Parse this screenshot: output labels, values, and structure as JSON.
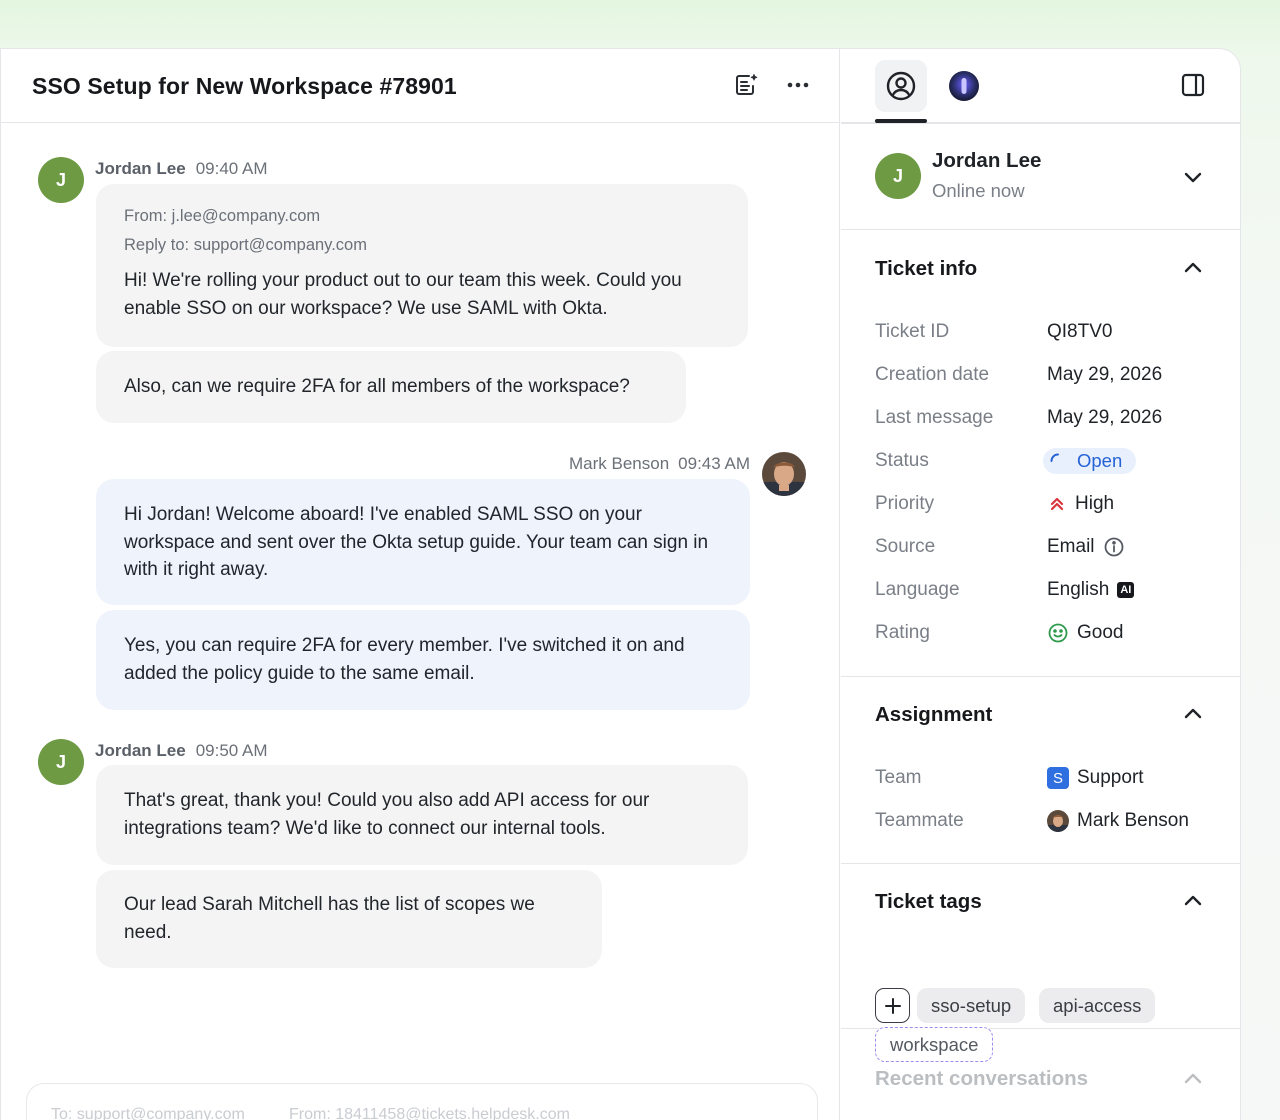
{
  "ticket": {
    "title": "SSO Setup for New Workspace #78901"
  },
  "messages": [
    {
      "author": "Jordan Lee",
      "initial": "J",
      "time": "09:40 AM",
      "from_line": "From: j.lee@company.com",
      "reply_line": "Reply to: support@company.com",
      "bubble1": "Hi! We're rolling your product out to our team this week. Could you enable SSO on our workspace? We use SAML with Okta.",
      "bubble2": "Also, can we require 2FA for all members of the workspace?"
    },
    {
      "author": "Mark Benson",
      "time": "09:43 AM",
      "bubble1": "Hi Jordan! Welcome aboard! I've enabled SAML SSO on your workspace and sent over the Okta setup guide. Your team can sign in with it right away.",
      "bubble2": "Yes, you can require 2FA for every member. I've switched it on and added the policy guide to the same email."
    },
    {
      "author": "Jordan Lee",
      "initial": "J",
      "time": "09:50 AM",
      "bubble1": "That's great, thank you! Could you also add API access for our integrations team? We'd like to connect our internal tools.",
      "bubble2": "Our lead Sarah Mitchell has the list of scopes we need."
    }
  ],
  "composer": {
    "to": "To: support@company.com",
    "from": "From: 18411458@tickets.helpdesk.com"
  },
  "customer": {
    "initial": "J",
    "name": "Jordan Lee",
    "presence": "Online now"
  },
  "ticket_info": {
    "title": "Ticket info",
    "rows": [
      {
        "label": "Ticket ID",
        "value": "QI8TV0"
      },
      {
        "label": "Creation date",
        "value": "May 29, 2026"
      },
      {
        "label": "Last message",
        "value": "May 29, 2026"
      },
      {
        "label": "Status",
        "value": "Open"
      },
      {
        "label": "Priority",
        "value": "High"
      },
      {
        "label": "Source",
        "value": "Email"
      },
      {
        "label": "Language",
        "value": "English",
        "badge": "AI"
      },
      {
        "label": "Rating",
        "value": "Good"
      }
    ]
  },
  "assignment": {
    "title": "Assignment",
    "team_label": "Team",
    "team_badge": "S",
    "team_value": "Support",
    "teammate_label": "Teammate",
    "teammate_value": "Mark Benson"
  },
  "tags": {
    "title": "Ticket tags",
    "items": [
      "sso-setup",
      "api-access"
    ],
    "draft": "workspace"
  },
  "recent": {
    "title": "Recent conversations"
  },
  "colors": {
    "accent_green": "#6d9a43",
    "status_blue": "#2462d6",
    "priority_red": "#d9363e",
    "rating_green": "#2f9a4c"
  }
}
